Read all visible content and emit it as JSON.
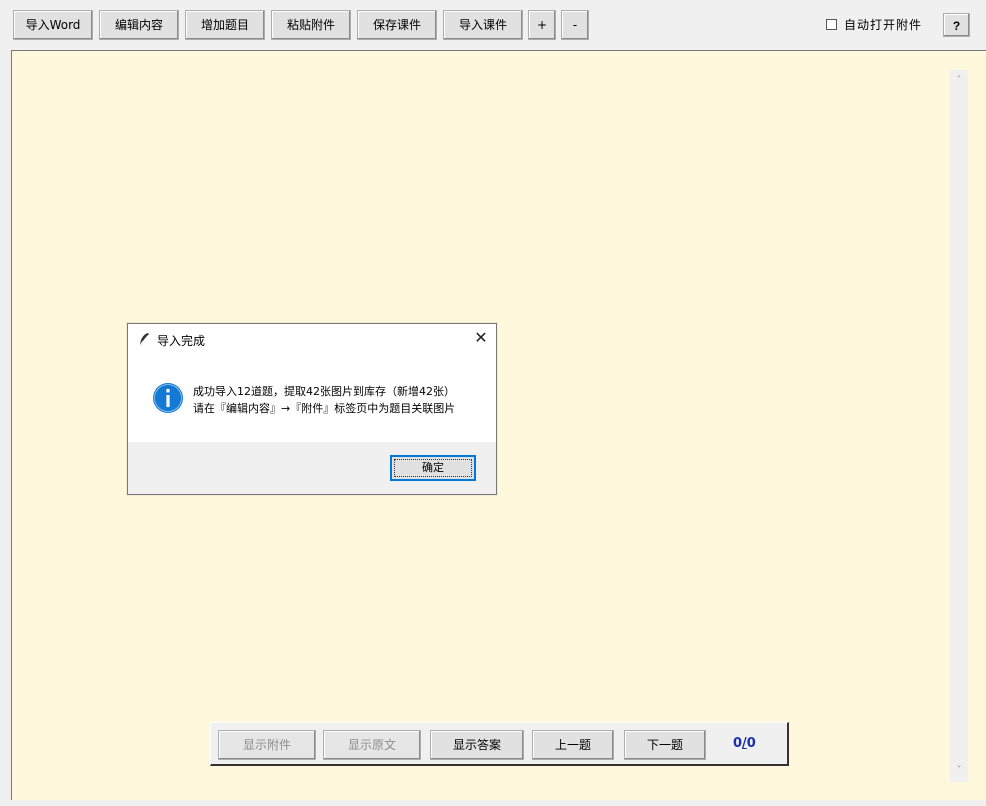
{
  "toolbar": {
    "import_word": "导入Word",
    "edit_content": "编辑内容",
    "add_question": "增加题目",
    "paste_attachment": "粘贴附件",
    "save_courseware": "保存课件",
    "import_courseware": "导入课件",
    "zoom_in": "+",
    "zoom_out": "-",
    "auto_open_label": "自动打开附件",
    "auto_open_checked": false,
    "help": "?"
  },
  "dialog": {
    "title": "导入完成",
    "message_line1": "成功导入12道题，提取42张图片到库存（新增42张）",
    "message_line2": "请在『编辑内容』→『附件』标签页中为题目关联图片",
    "ok_label": "确定",
    "icon": "info-icon"
  },
  "nav": {
    "show_attachment": "显示附件",
    "show_original": "显示原文",
    "show_answer": "显示答案",
    "prev": "上一题",
    "next": "下一题",
    "counter_current": "0",
    "counter_sep": "/",
    "counter_total": "0"
  },
  "colors": {
    "content_bg": "#fff8dc",
    "counter": "#1a2faa",
    "info_blue": "#1479d4"
  }
}
